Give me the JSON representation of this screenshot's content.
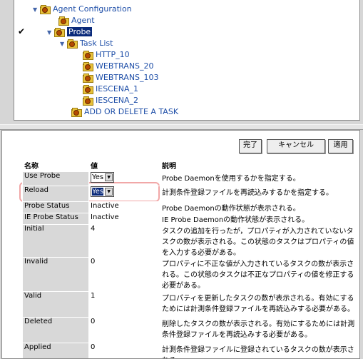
{
  "tree": {
    "agent_configuration": "Agent Configuration",
    "agent": "Agent",
    "probe": "Probe",
    "task_list": "Task List",
    "tasks": [
      "HTTP_10",
      "WEBTRANS_20",
      "WEBTRANS_103",
      "IESCENA_1",
      "IESCENA_2"
    ],
    "add_delete": "ADD OR DELETE A TASK"
  },
  "buttons": {
    "done": "完了",
    "cancel": "キャンセル",
    "apply": "適用"
  },
  "table": {
    "headers": {
      "name": "名称",
      "value": "値",
      "description": "説明"
    },
    "rows": [
      {
        "name": "Use Probe",
        "value": "Yes",
        "desc": "Probe Daemonを使用するかを指定する。"
      },
      {
        "name": "Reload",
        "value": "Yes",
        "desc": "計測条件登録ファイルを再読込みするかを指定する。"
      },
      {
        "name": "Probe Status",
        "value": "Inactive",
        "desc": "Probe Daemonの動作状態が表示される。"
      },
      {
        "name": "IE Probe Status",
        "value": "Inactive",
        "desc": "IE Probe Daemonの動作状態が表示される。"
      },
      {
        "name": "Initial",
        "value": "4",
        "desc": "タスクの追加を行ったが，プロパティが入力されていないタスクの数が表示される。この状態のタスクはプロパティの値を入力する必要がある。"
      },
      {
        "name": "Invalid",
        "value": "0",
        "desc": "プロパティに不正な値が入力されているタスクの数が表示される。この状態のタスクは不正なプロパティの値を修正する必要がある。"
      },
      {
        "name": "Valid",
        "value": "1",
        "desc": "プロパティを更新したタスクの数が表示される。有効にするためには計測条件登録ファイルを再読込みする必要がある。"
      },
      {
        "name": "Deleted",
        "value": "0",
        "desc": "削除したタスクの数が表示される。有効にするためには計測条件登録ファイルを再読込みする必要がある。"
      },
      {
        "name": "Applied",
        "value": "0",
        "desc": "計測条件登録ファイルに登録されているタスクの数が表示される。"
      }
    ]
  }
}
